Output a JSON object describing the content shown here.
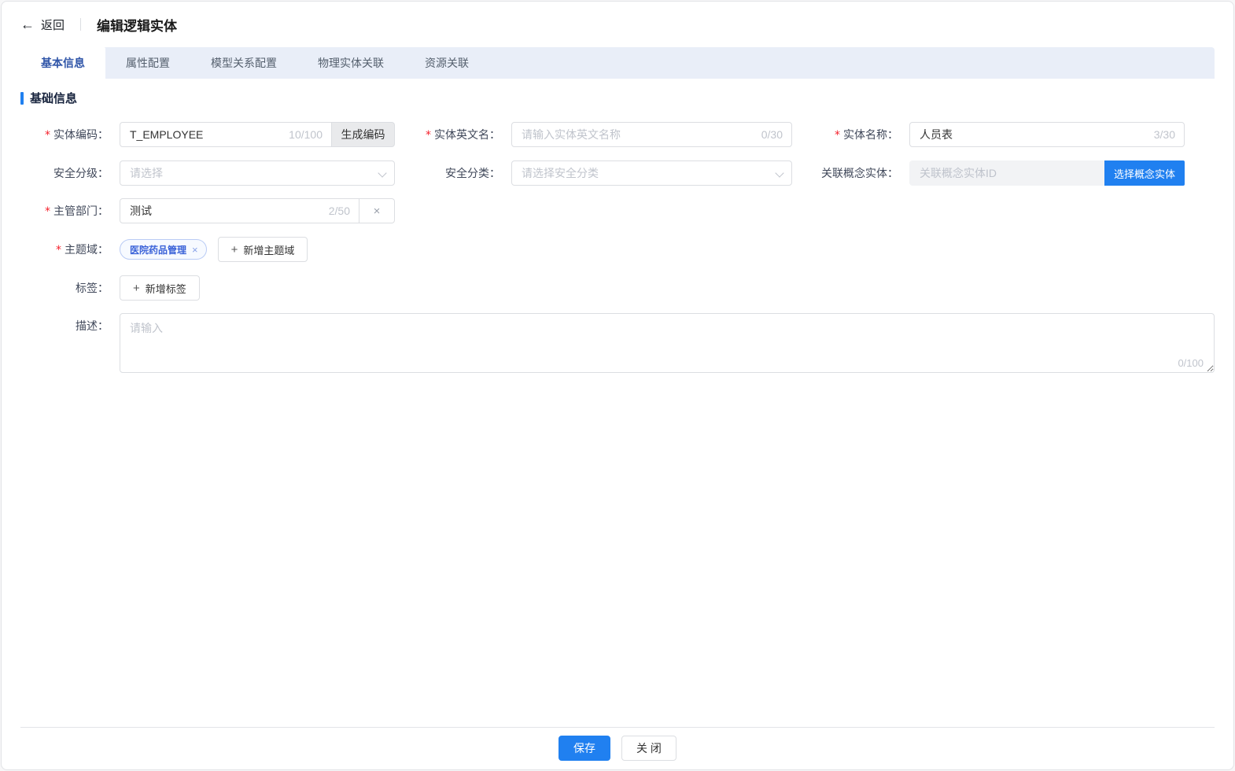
{
  "ui": {
    "required_mark": "*"
  },
  "colors": {
    "accent": "#2080f0",
    "tab_bar_bg": "#e9eef8",
    "active_tab_text": "#2f55a8",
    "tag_text": "#3a62d8",
    "danger": "#f5222d"
  },
  "header": {
    "back_label": "返回",
    "back_icon": "←",
    "title": "编辑逻辑实体"
  },
  "tabs": [
    {
      "label": "基本信息",
      "active": true
    },
    {
      "label": "属性配置",
      "active": false
    },
    {
      "label": "模型关系配置",
      "active": false
    },
    {
      "label": "物理实体关联",
      "active": false
    },
    {
      "label": "资源关联",
      "active": false
    }
  ],
  "section": {
    "title": "基础信息"
  },
  "form": {
    "entity_code": {
      "label": "实体编码：",
      "required": true,
      "value": "T_EMPLOYEE",
      "counter": "10/100",
      "button_label": "生成编码"
    },
    "entity_en_name": {
      "label": "实体英文名：",
      "required": true,
      "placeholder": "请输入实体英文名称",
      "counter": "0/30"
    },
    "entity_name": {
      "label": "实体名称：",
      "required": true,
      "value": "人员表",
      "counter": "3/30"
    },
    "security_level": {
      "label": "安全分级：",
      "placeholder": "请选择"
    },
    "security_category": {
      "label": "安全分类：",
      "placeholder": "请选择安全分类"
    },
    "concept_entity": {
      "label": "关联概念实体：",
      "placeholder": "关联概念实体ID",
      "button_label": "选择概念实体"
    },
    "department": {
      "label": "主管部门：",
      "required": true,
      "value": "测试",
      "counter": "2/50",
      "clear_icon": "×"
    },
    "subject_domain": {
      "label": "主题域：",
      "required": true,
      "tag": "医院药品管理",
      "tag_close_icon": "×",
      "add_button_label": "新增主题域",
      "plus_icon": "+"
    },
    "tags": {
      "label": "标签：",
      "add_button_label": "新增标签",
      "plus_icon": "+"
    },
    "description": {
      "label": "描述：",
      "placeholder": "请输入",
      "counter": "0/100"
    }
  },
  "footer": {
    "save_label": "保存",
    "close_label": "关 闭"
  }
}
